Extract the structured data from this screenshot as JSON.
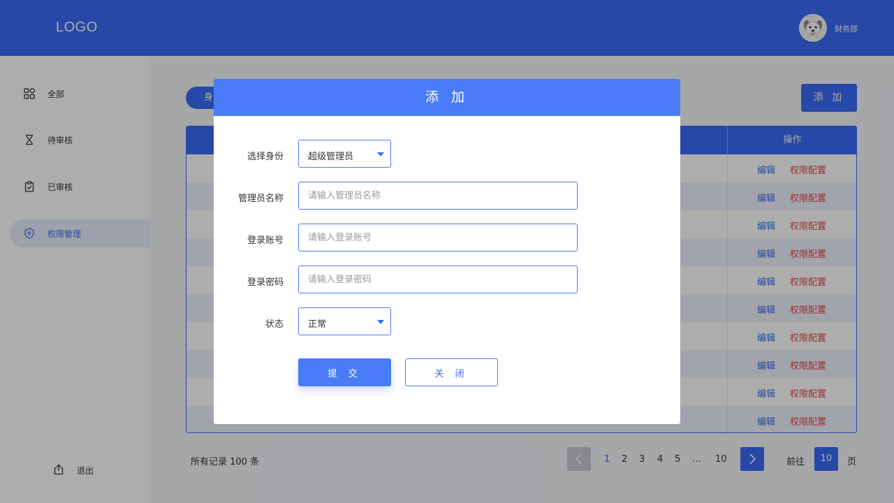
{
  "header": {
    "logo": "LOGO",
    "user_name": "财务部"
  },
  "sidebar": {
    "items": [
      {
        "label": "全部",
        "icon": "grid-icon"
      },
      {
        "label": "待审核",
        "icon": "hourglass-icon"
      },
      {
        "label": "已审核",
        "icon": "clipboard-check-icon"
      },
      {
        "label": "权限管理",
        "icon": "shield-icon",
        "active": true
      }
    ],
    "logout_label": "退出"
  },
  "main": {
    "filter_label": "身",
    "add_button": "添 加",
    "table": {
      "op_header": "操作",
      "edit_label": "编辑",
      "perm_label": "权限配置",
      "row_count": 10
    },
    "total_records": "所有记录 100 条",
    "pagination": {
      "pages": [
        "1",
        "2",
        "3",
        "4",
        "5",
        "…",
        "10"
      ],
      "active_page": "1",
      "goto_label": "前往",
      "goto_value": "10",
      "page_suffix": "页"
    }
  },
  "modal": {
    "title": "添 加",
    "fields": {
      "role": {
        "label": "选择身份",
        "value": "超级管理员"
      },
      "admin_name": {
        "label": "管理员名称",
        "placeholder": "请输入管理员名称"
      },
      "account": {
        "label": "登录账号",
        "placeholder": "请输入登录账号"
      },
      "password": {
        "label": "登录密码",
        "placeholder": "请输入登录密码"
      },
      "status": {
        "label": "状态",
        "value": "正常"
      }
    },
    "submit_label": "提 交",
    "close_label": "关 闭"
  },
  "colors": {
    "primary": "#3a6bf5",
    "danger": "#e8464c"
  }
}
